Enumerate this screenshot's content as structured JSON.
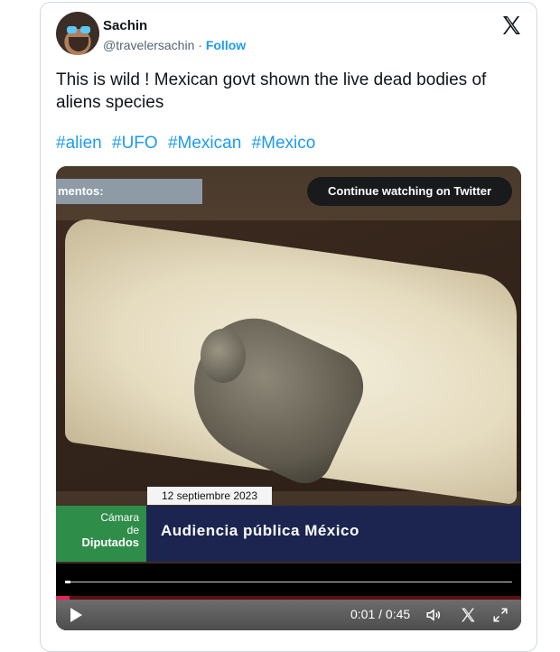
{
  "tweet": {
    "author_name": "Sachin",
    "handle": "@travelersachin",
    "separator": "·",
    "follow_label": "Follow",
    "text": "This is wild ! Mexican govt shown the live dead bodies of aliens species",
    "hashtags": [
      "#alien",
      "#UFO",
      "#Mexican",
      "#Mexico"
    ]
  },
  "video": {
    "ticker_text": "mentos:",
    "continue_label": "Continue watching on Twitter",
    "date_tag": "12 septiembre 2023",
    "channel_line1": "Cámara",
    "channel_line2": "de",
    "channel_line3": "Diputados",
    "headline": "Audiencia pública México",
    "time": "0:01 / 0:45",
    "progress": 0.03
  },
  "colors": {
    "accent": "#1d9bf0",
    "text": "#0f1419",
    "muted": "#536471",
    "progress": "#e0245e"
  },
  "icons": {
    "logo": "x-logo-icon",
    "play": "play-icon",
    "volume": "volume-icon",
    "x_small": "x-logo-small-icon",
    "fullscreen": "fullscreen-icon"
  }
}
